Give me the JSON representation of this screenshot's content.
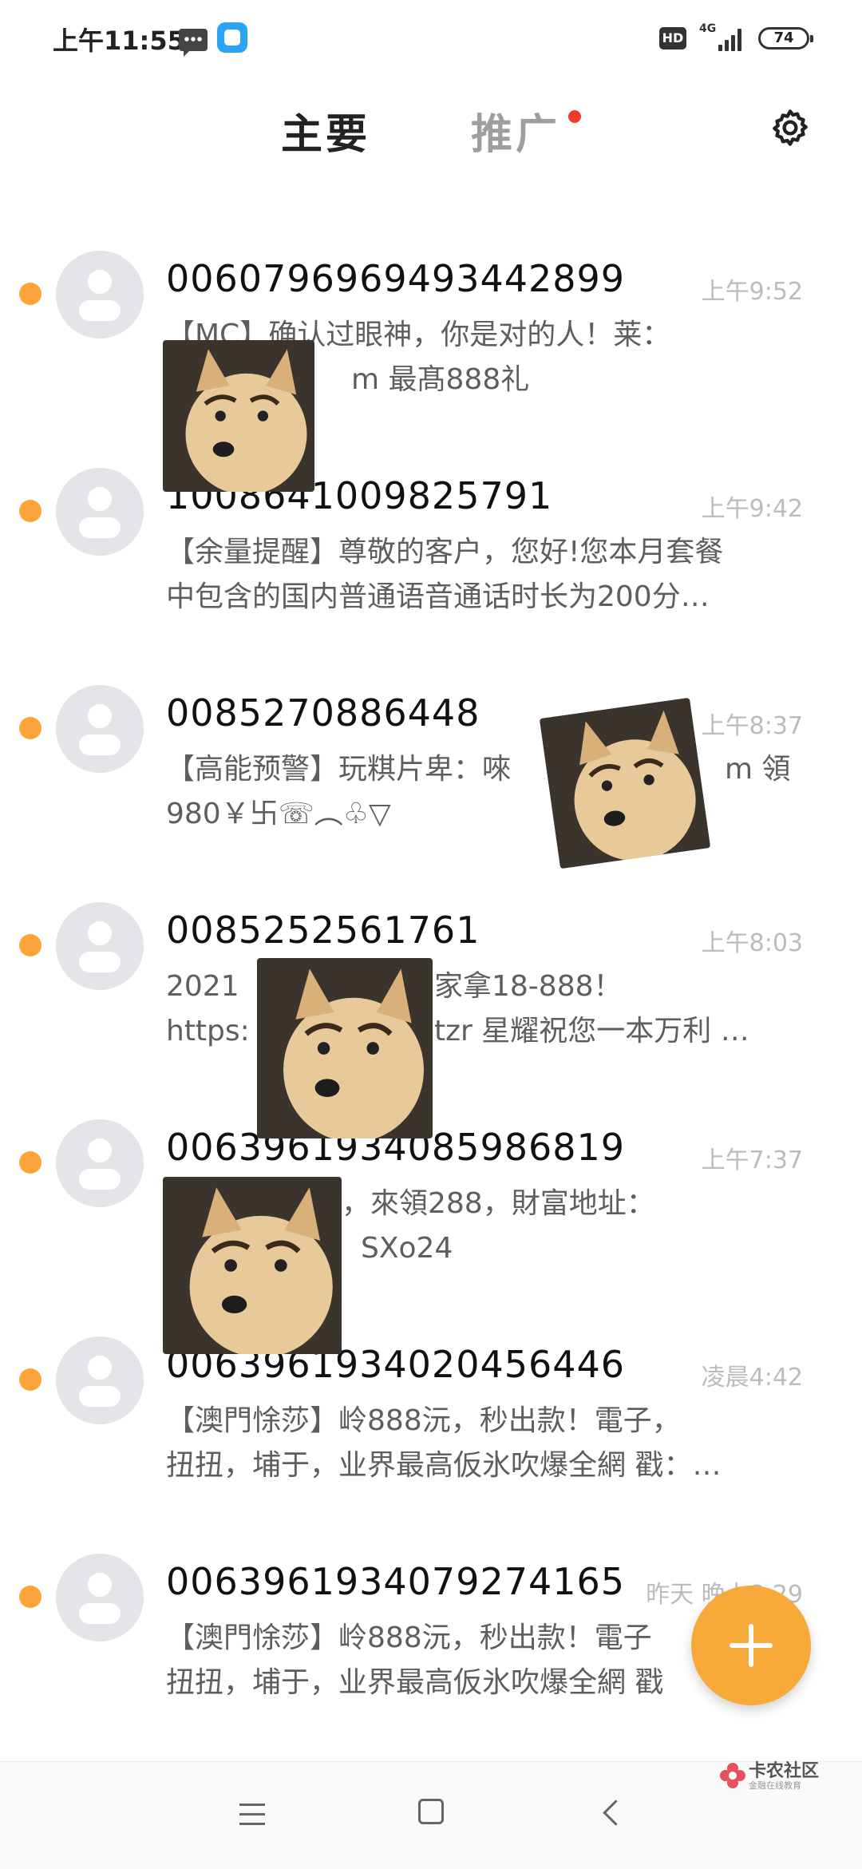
{
  "status_bar": {
    "time": "上午11:55",
    "hd": "HD",
    "network": "4G",
    "battery": "74"
  },
  "header": {
    "tab_main": "主要",
    "tab_promo": "推广",
    "icons": [
      "gear-icon"
    ]
  },
  "messages": [
    {
      "sender": "0060796969493442899",
      "time": "上午9:52",
      "lines": [
        "【MC】确认过眼神，你是对的人！莱：",
        "m  最髙888礼"
      ],
      "unread": true
    },
    {
      "sender": "10086410098257​91",
      "time": "上午9:42",
      "lines": [
        "【余量提醒】尊敬的客户，您好!您本月套餐",
        "中包含的国内普通语音通话时长为200分…"
      ],
      "unread": true
    },
    {
      "sender": "0085270886448",
      "time": "上午8:37",
      "lines": [
        "【高能预警】玩粸片卑：唻",
        "980￥卐☏︵♧▽"
      ],
      "unread": true
    },
    {
      "sender": "0085252561761",
      "time": "上午8:03",
      "lines": [
        "2021",
        "https:"
      ],
      "lines_tail": [
        "家拿18-888！",
        "tzr 星耀祝您一本万利 …"
      ],
      "unread": true
    },
    {
      "sender": "0063961934085986819",
      "time": "上午7:37",
      "lines": [
        "，來領288，財富地址：",
        "SXo24"
      ],
      "unread": true
    },
    {
      "sender": "0063961934020456446",
      "time": "凌晨4:42",
      "lines": [
        "【澳門悇莎】岭888沅，秒出款！電子，",
        "扭扭，埔于，业界最高仮氷吹爆全網 戳：…"
      ],
      "unread": true
    },
    {
      "sender": "0063961934079274165",
      "time": "昨天 晚上8:29",
      "lines": [
        "【澳門悇莎】岭888沅，秒出款！電子",
        "扭扭，埔于，业界最高仮氷吹爆全網 戳"
      ],
      "unread": true
    }
  ],
  "message_3_tail_m": "m 領",
  "fab": {
    "icon": "plus-icon"
  },
  "nav": {
    "icons": [
      "menu-icon",
      "home-icon",
      "back-icon"
    ]
  },
  "watermark": {
    "title": "卡农社区",
    "subtitle": "金融在线教育"
  }
}
